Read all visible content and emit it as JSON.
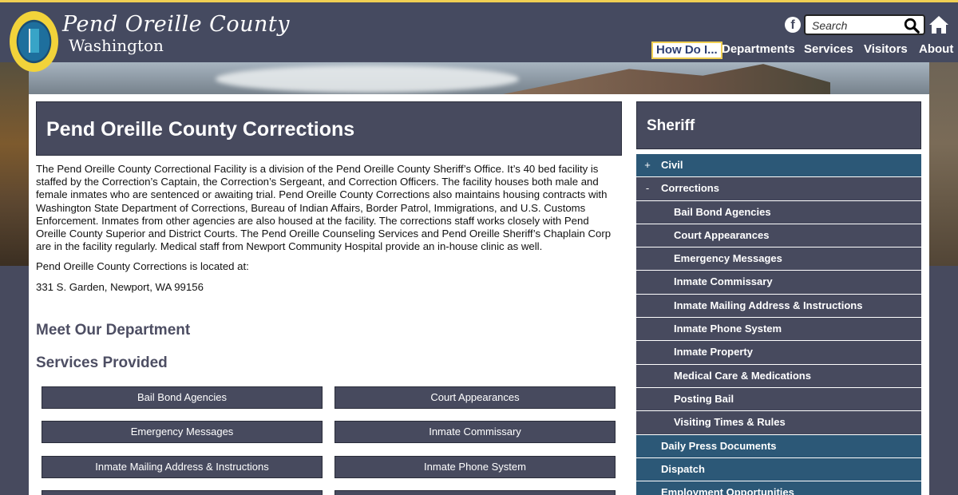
{
  "header": {
    "brand_line1": "Pend Oreille County",
    "brand_line2": "Washington",
    "search_placeholder": "Search",
    "facebook_label": "f",
    "nav": [
      {
        "label": "How Do I..."
      },
      {
        "label": "Departments"
      },
      {
        "label": "Services"
      },
      {
        "label": "Visitors"
      },
      {
        "label": "About"
      }
    ]
  },
  "main": {
    "title": "Pend Oreille County Corrections",
    "paragraphs": [
      "The Pend Oreille County Correctional Facility is a division of the Pend Oreille County Sheriff’s Office. It’s 40 bed facility is staffed by the Correction’s Captain, the Correction’s Sergeant, and Correction Officers. The facility houses both male and female inmates who are sentenced or awaiting trial. Pend Oreille County Corrections also maintains housing contracts with Washington State Department of Corrections, Bureau of Indian Affairs, Border Patrol, Immigrations, and U.S. Customs Enforcement. Inmates from other agencies are also housed at the facility. The corrections staff works closely with Pend Oreille County Superior and District Courts. The Pend Oreille Counseling Services and Pend Oreille Sheriff’s Chaplain Corp are in the facility regularly. Medical staff from Newport Community Hospital provide an in-house clinic as well.",
      "Pend Oreille County Corrections is located at:",
      "331 S. Garden, Newport, WA 99156"
    ],
    "meet_heading": "Meet Our Department",
    "services_heading": "Services Provided",
    "services": [
      "Bail Bond Agencies",
      "Court Appearances",
      "Emergency Messages",
      "Inmate Commissary",
      "Inmate Mailing Address & Instructions",
      "Inmate Phone System"
    ]
  },
  "sidebar": {
    "title": "Sheriff",
    "items": [
      {
        "label": "Civil",
        "toggle": "+"
      },
      {
        "label": "Corrections",
        "toggle": "-"
      },
      {
        "label": "Bail Bond Agencies"
      },
      {
        "label": "Court Appearances"
      },
      {
        "label": "Emergency Messages"
      },
      {
        "label": "Inmate Commissary"
      },
      {
        "label": "Inmate Mailing Address & Instructions"
      },
      {
        "label": "Inmate Phone System"
      },
      {
        "label": "Inmate Property"
      },
      {
        "label": "Medical Care & Medications"
      },
      {
        "label": "Posting Bail"
      },
      {
        "label": "Visiting Times & Rules"
      },
      {
        "label": "Daily Press Documents"
      },
      {
        "label": "Dispatch"
      },
      {
        "label": "Employment Opportunities"
      }
    ]
  },
  "colors": {
    "header_bg": "#454a60",
    "accent_gold": "#f0cf53",
    "panel_dark": "#474a5e",
    "sidebar_blue": "#2c5877",
    "heading_text": "#4d4e63"
  },
  "icons": [
    "seal-logo",
    "facebook-icon",
    "search-icon",
    "home-icon"
  ]
}
